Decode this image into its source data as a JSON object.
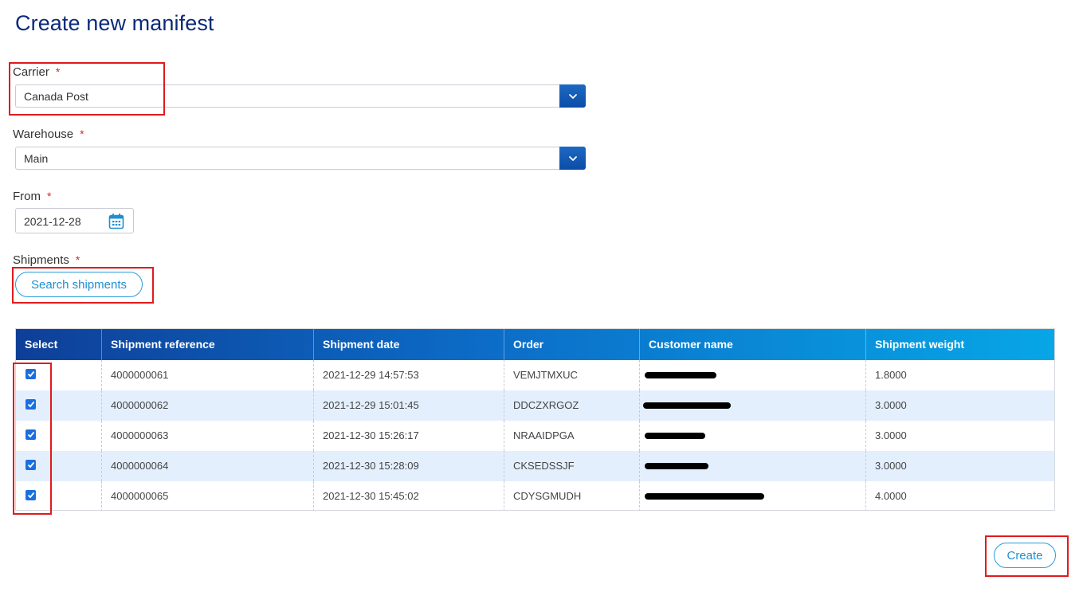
{
  "page": {
    "title": "Create new manifest"
  },
  "form": {
    "carrier": {
      "label": "Carrier",
      "required_mark": "*",
      "value": "Canada Post"
    },
    "warehouse": {
      "label": "Warehouse",
      "required_mark": "*",
      "value": "Main"
    },
    "from": {
      "label": "From",
      "required_mark": "*",
      "value": "2021-12-28"
    },
    "shipments": {
      "label": "Shipments",
      "required_mark": "*",
      "search_button": "Search shipments"
    }
  },
  "table": {
    "headers": [
      "Select",
      "Shipment reference",
      "Shipment date",
      "Order",
      "Customer name",
      "Shipment weight"
    ],
    "rows": [
      {
        "checked": true,
        "reference": "4000000061",
        "date": "2021-12-29 14:57:53",
        "order": "VEMJTMXUC",
        "customer": "",
        "weight": "1.8000"
      },
      {
        "checked": true,
        "reference": "4000000062",
        "date": "2021-12-29 15:01:45",
        "order": "DDCZXRGOZ",
        "customer": "",
        "weight": "3.0000"
      },
      {
        "checked": true,
        "reference": "4000000063",
        "date": "2021-12-30 15:26:17",
        "order": "NRAAIDPGA",
        "customer": "",
        "weight": "3.0000"
      },
      {
        "checked": true,
        "reference": "4000000064",
        "date": "2021-12-30 15:28:09",
        "order": "CKSEDSSJF",
        "customer": "",
        "weight": "3.0000"
      },
      {
        "checked": true,
        "reference": "4000000065",
        "date": "2021-12-30 15:45:02",
        "order": "CDYSGMUDH",
        "customer": "",
        "weight": "4.0000"
      }
    ]
  },
  "actions": {
    "create": "Create"
  },
  "colors": {
    "title": "#0b2a7a",
    "accent": "#1f8fd0",
    "highlight_box": "#e01b1b",
    "checkbox": "#1a6fe0"
  },
  "icons": {
    "dropdown": "chevron-down-icon",
    "date": "calendar-icon",
    "checkbox": "checkmark-icon"
  }
}
